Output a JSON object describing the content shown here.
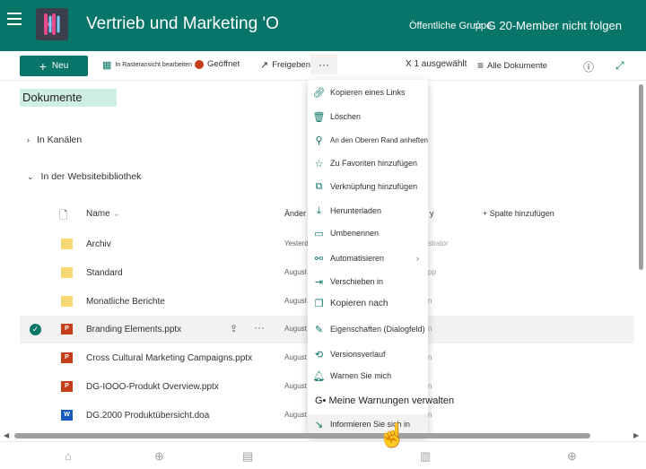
{
  "header": {
    "site_title": "Vertrieb und Marketing 'O",
    "group_type": "Öffentliche Gruppe",
    "follow_label": "G 20-Member nicht folgen",
    "accent": "#077568"
  },
  "toolbar": {
    "new_label": "Neu",
    "grid_view_label": "In Rasteransicht bearbeiten",
    "open_label": "Geöffnet",
    "share_label": "Freigeben",
    "more_label": "···",
    "selected_count": "X 1 ausgewählt",
    "view_label": "Alle Dokumente"
  },
  "main": {
    "library_title": "Dokumente",
    "section_channels": "In Kanälen",
    "section_site_library": "In der Websitebibliothek",
    "columns": {
      "name": "Name",
      "modified": "Änder",
      "modified_by": "y",
      "add_column": "+ Spalte hinzufügen"
    },
    "files": [
      {
        "name": "Archiv",
        "type": "folder",
        "date": "Yesterd",
        "modified_by": "strator"
      },
      {
        "name": "Standard",
        "type": "folder",
        "date": "August",
        "modified_by": "pp"
      },
      {
        "name": "Monatliche Berichte",
        "type": "folder",
        "date": "August",
        "modified_by": "n"
      },
      {
        "name": "Branding Elements.pptx",
        "type": "pptx",
        "date": "August",
        "modified_by": "n"
      },
      {
        "name": "Cross Cultural Marketing Campaigns.pptx",
        "type": "pptx",
        "date": "August",
        "modified_by": "n"
      },
      {
        "name": "DG-IOOO-Produkt Overview.pptx",
        "type": "pptx",
        "date": "August",
        "modified_by": "n"
      },
      {
        "name": "DG.2000 Produktübersicht.doa",
        "type": "docx",
        "date": "August",
        "modified_by": "n"
      }
    ]
  },
  "context_menu": {
    "items": [
      {
        "label": "Kopieren eines Links",
        "icon": "link-icon"
      },
      {
        "label": "Löschen",
        "icon": "trash-icon"
      },
      {
        "label": "An den Oberen Rand anheften",
        "icon": "pin-icon"
      },
      {
        "label": "Zu Favoriten hinzufügen",
        "icon": "star-icon"
      },
      {
        "label": "Verknüpfung hinzufügen",
        "icon": "shortcut-icon"
      },
      {
        "label": "Herunterladen",
        "icon": "download-icon"
      },
      {
        "label": "Umbenennen",
        "icon": "rename-icon"
      },
      {
        "label": "Automatisieren",
        "icon": "automate-icon"
      },
      {
        "label": "Verschieben in",
        "icon": "move-icon"
      },
      {
        "label": "Kopieren nach",
        "icon": "copy-icon"
      },
      {
        "label": "Eigenschaften (Dialogfeld)",
        "icon": "edit-icon"
      },
      {
        "label": "Versionsverlauf",
        "icon": "history-icon"
      },
      {
        "label": "Warnen Sie mich",
        "icon": "bell-icon"
      },
      {
        "label": "G• Meine Warnungen verwalten",
        "icon": ""
      },
      {
        "label": "Informieren Sie sich in",
        "icon": "arrow-icon"
      }
    ]
  }
}
